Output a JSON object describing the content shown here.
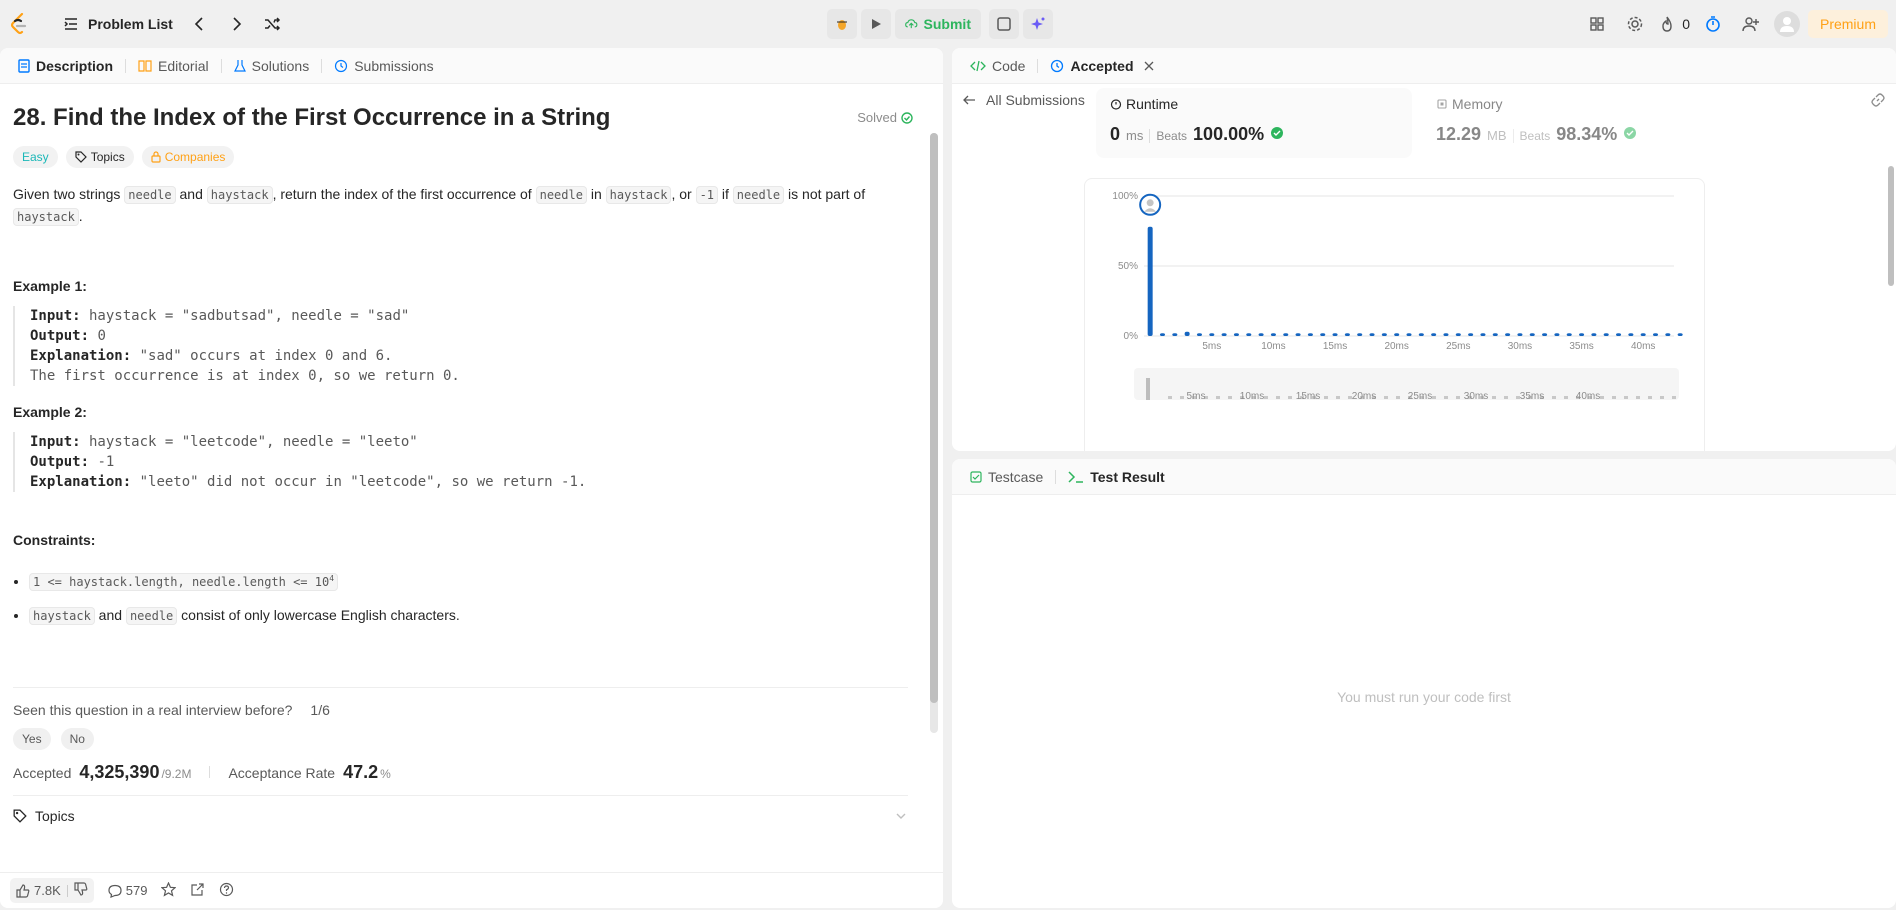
{
  "topbar": {
    "problem_list": "Problem List",
    "submit": "Submit",
    "streak": "0",
    "premium": "Premium"
  },
  "left": {
    "tabs": [
      "Description",
      "Editorial",
      "Solutions",
      "Submissions"
    ],
    "title": "28. Find the Index of the First Occurrence in a String",
    "solved": "Solved",
    "tags": {
      "difficulty": "Easy",
      "topics": "Topics",
      "companies": "Companies"
    },
    "desc": {
      "p1": "Given two strings ",
      "c1": "needle",
      "p2": " and ",
      "c2": "haystack",
      "p3": ", return the index of the first occurrence of ",
      "c3": "needle",
      "p4": " in ",
      "c4": "haystack",
      "p5": ", or ",
      "c5": "-1",
      "p6": " if ",
      "c6": "needle",
      "p7": " is not part of ",
      "c7": "haystack",
      "p8": "."
    },
    "example1": {
      "heading": "Example 1:",
      "input_label": "Input:",
      "input": " haystack = \"sadbutsad\", needle = \"sad\"",
      "output_label": "Output:",
      "output": " 0",
      "expl_label": "Explanation:",
      "expl": " \"sad\" occurs at index 0 and 6.",
      "expl2": "The first occurrence is at index 0, so we return 0."
    },
    "example2": {
      "heading": "Example 2:",
      "input_label": "Input:",
      "input": " haystack = \"leetcode\", needle = \"leeto\"",
      "output_label": "Output:",
      "output": " -1",
      "expl_label": "Explanation:",
      "expl": " \"leeto\" did not occur in \"leetcode\", so we return -1."
    },
    "constraints": {
      "heading": "Constraints:",
      "c1": "1 <= haystack.length, needle.length <= 10",
      "c1_sup": "4",
      "c2a": "haystack",
      "c2b": " and ",
      "c2c": "needle",
      "c2d": " consist of only lowercase English characters."
    },
    "seen": {
      "question": "Seen this question in a real interview before?",
      "count": "1/6",
      "yes": "Yes",
      "no": "No"
    },
    "stats": {
      "accepted_label": "Accepted",
      "accepted": "4,325,390",
      "total": "/9.2M",
      "rate_label": "Acceptance Rate",
      "rate": "47.2",
      "rate_unit": "%"
    },
    "topics_label": "Topics",
    "bottom": {
      "likes": "7.8K",
      "comments": "579"
    }
  },
  "right": {
    "tabs": {
      "code": "Code",
      "accepted": "Accepted"
    },
    "all_submissions": "All Submissions",
    "runtime": {
      "label": "Runtime",
      "value": "0",
      "unit": "ms",
      "beats_label": "Beats",
      "beats": "100.00%"
    },
    "memory": {
      "label": "Memory",
      "value": "12.29",
      "unit": "MB",
      "beats_label": "Beats",
      "beats": "98.34%"
    },
    "bottom_tabs": {
      "testcase": "Testcase",
      "result": "Test Result"
    },
    "empty": "You must run your code first"
  },
  "chart_data": {
    "type": "bar",
    "xlabel": "",
    "ylabel": "",
    "y_ticks": [
      "100%",
      "50%",
      "0%"
    ],
    "x_ticks": [
      "5ms",
      "10ms",
      "15ms",
      "20ms",
      "25ms",
      "30ms",
      "35ms",
      "40ms"
    ],
    "ylim": [
      0,
      100
    ],
    "xlim": [
      0,
      43
    ],
    "values": [
      78,
      2,
      2,
      3,
      2,
      2,
      2,
      2,
      2,
      2,
      2,
      2,
      2,
      2,
      2,
      2,
      2,
      2,
      2,
      2,
      2,
      2,
      2,
      2,
      2,
      2,
      2,
      2,
      2,
      2,
      2,
      2,
      2,
      2,
      2,
      2,
      2,
      2,
      2,
      2,
      2,
      2,
      2,
      2
    ],
    "highlight_index": 0,
    "colors": {
      "bar": "#1565c0",
      "highlight": "#1565c0",
      "grid": "#e5e5e5"
    }
  }
}
